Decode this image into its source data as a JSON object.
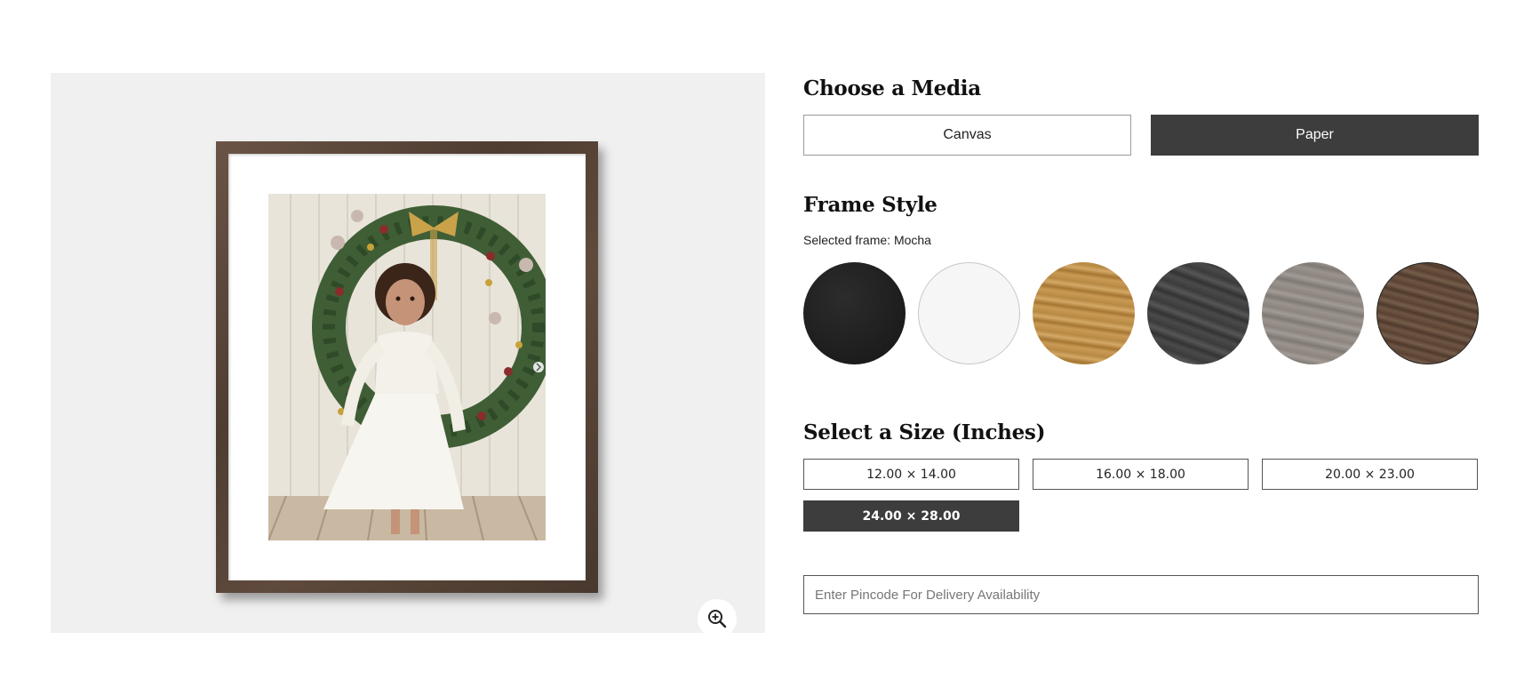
{
  "media": {
    "heading": "Choose a Media",
    "options": [
      "Canvas",
      "Paper"
    ],
    "selected": "Paper"
  },
  "frame": {
    "heading": "Frame Style",
    "selected_label": "Selected frame: Mocha",
    "swatches": [
      {
        "name": "black",
        "color": "#1f1f1f"
      },
      {
        "name": "white",
        "color": "#f6f6f6"
      },
      {
        "name": "oak",
        "color": "#b98b45"
      },
      {
        "name": "charcoal",
        "color": "#424242"
      },
      {
        "name": "grey",
        "color": "#8f8882"
      },
      {
        "name": "mocha",
        "color": "#5c4535"
      }
    ],
    "selected": "mocha"
  },
  "size": {
    "heading": "Select a Size (Inches)",
    "options": [
      "12.00 × 14.00",
      "16.00 × 18.00",
      "20.00 × 23.00",
      "24.00 × 28.00"
    ],
    "selected": "24.00 × 28.00"
  },
  "pincode": {
    "placeholder": "Enter Pincode For Delivery Availability",
    "value": ""
  },
  "preview": {
    "zoom_icon": "zoom-in-icon",
    "frame_color": "#5a4536",
    "background": "#f0f0f0"
  },
  "colors": {
    "selected_button": "#3d3d3d",
    "border": "#9a9a9a"
  }
}
